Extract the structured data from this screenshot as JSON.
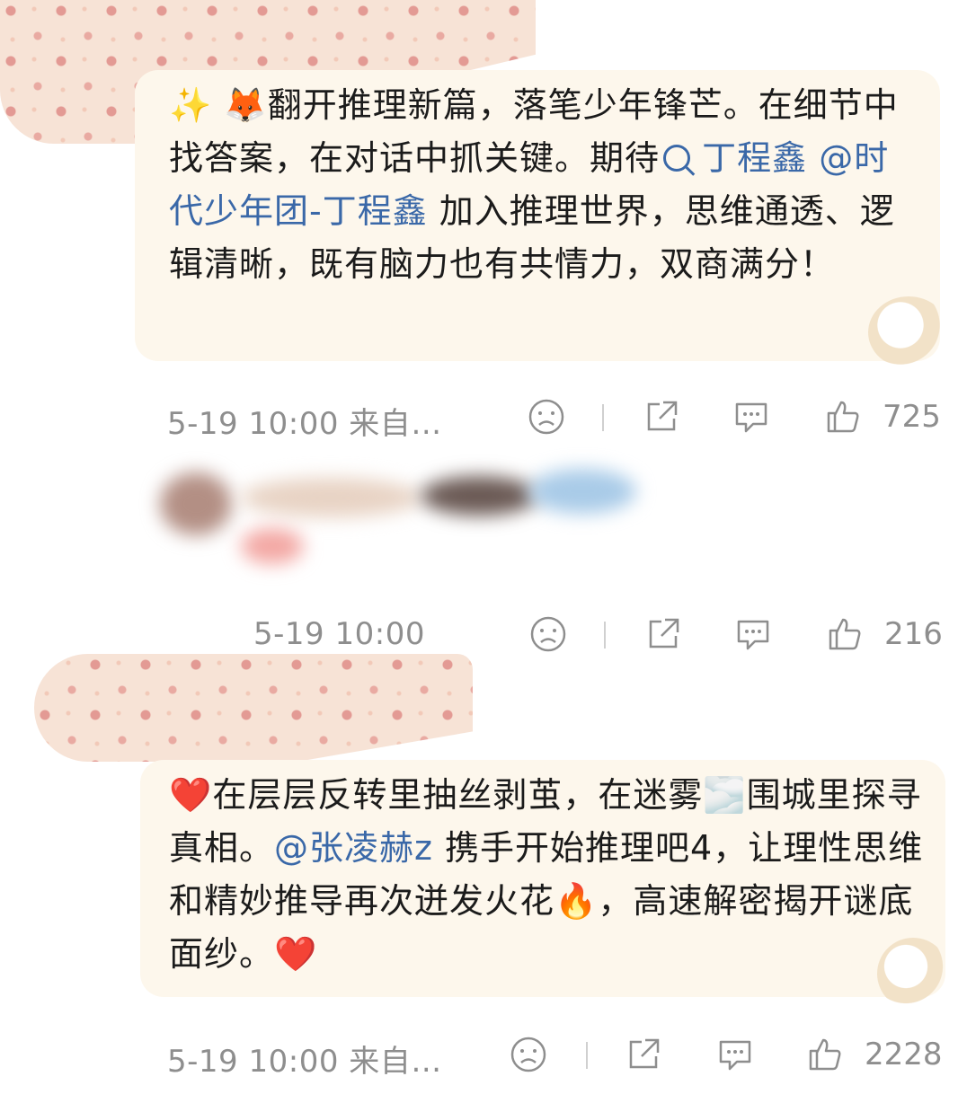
{
  "posts": [
    {
      "emoji": "✨ 🦊",
      "text_before_mention": "翻开推理新篇，落笔少年锋芒。在细节中找答案，在对话中抓关键。期待",
      "mention_search": "丁程鑫",
      "mention_user": "@时代少年团-丁程鑫",
      "text_after_mention": " 加入推理世界，思维通透、逻辑清晰，既有脑力也有共情力，双商满分！",
      "timestamp": "5-19 10:00",
      "source": "来自…",
      "likes": "725"
    },
    {
      "blurred_username": "",
      "timestamp": "5-19 10:00",
      "likes": "216"
    },
    {
      "emoji_heart": "❤️",
      "text_part1": "在层层反转里抽丝剥茧，在迷雾",
      "emoji_fog": "🌫️",
      "text_part2": "围城里探寻真相。",
      "mention_user": "@张凌赫z",
      "text_part3": " 携手开始推理吧4，让理性思维和精妙推导再次迸发火花",
      "emoji_fire": "🔥",
      "text_part4": "，高速解密揭开谜底面纱。",
      "emoji_heart_end": "❤️",
      "timestamp": "5-19 10:00",
      "source": "来自…",
      "likes": "2228"
    }
  ],
  "icons": [
    "sad-face-icon",
    "share-icon",
    "comment-icon",
    "thumbs-up-icon"
  ],
  "colors": {
    "text": "#1b1b1b",
    "mention": "#3a68a8",
    "meta": "#8e8e8e",
    "bubble": "#fdf7ec",
    "pattern": "#f7e3d6"
  }
}
